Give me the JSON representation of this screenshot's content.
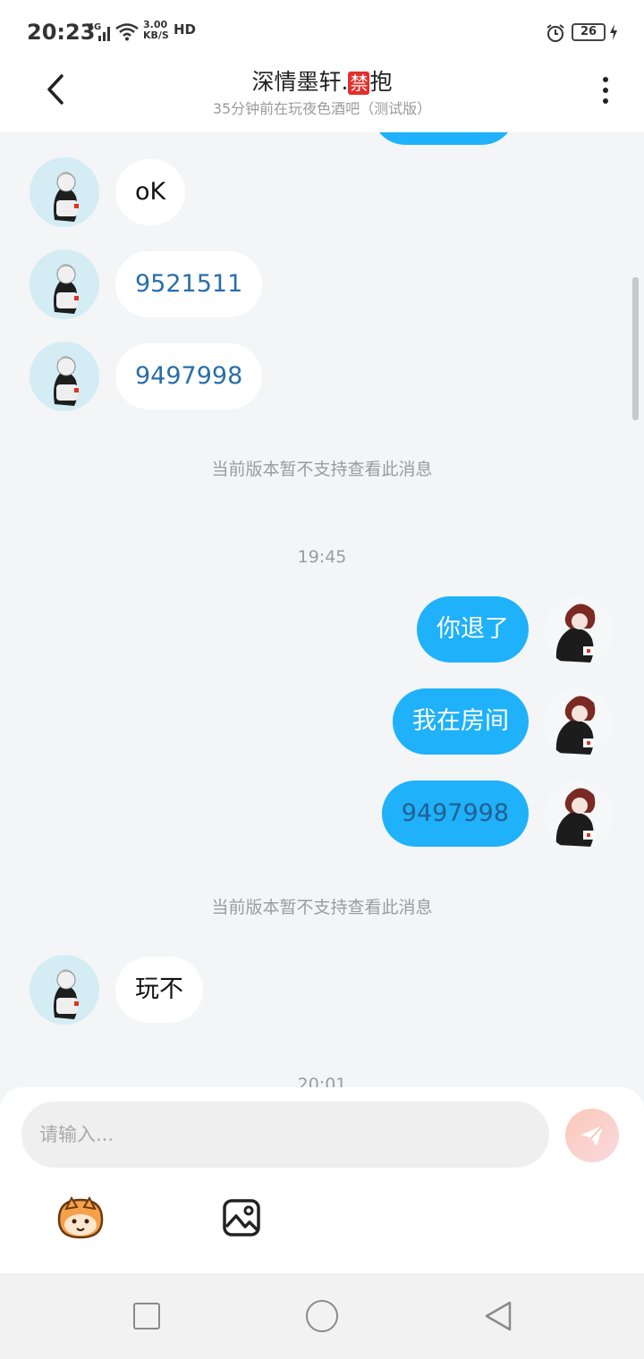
{
  "status_bar": {
    "time": "20:23",
    "network": "4G",
    "speed_value": "3.00",
    "speed_unit": "KB/S",
    "hd": "HD",
    "battery": "26"
  },
  "header": {
    "title_pre": "深情墨轩.",
    "title_badge": "禁",
    "title_post": "抱",
    "subtitle": "35分钟前在玩夜色酒吧（测试版）"
  },
  "messages": {
    "m1": "oK",
    "m2": "9521511",
    "m3": "9497998",
    "sys1": "当前版本暂不支持查看此消息",
    "time1": "19:45",
    "m4": "你退了",
    "m5": "我在房间",
    "m6": "9497998",
    "sys2": "当前版本暂不支持查看此消息",
    "m7": "玩不",
    "time2": "20:01"
  },
  "input": {
    "placeholder": "请输入..."
  },
  "colors": {
    "outgoing_bubble": "#1fb1f9",
    "incoming_bubble": "#ffffff",
    "background": "#f3f5f7"
  }
}
